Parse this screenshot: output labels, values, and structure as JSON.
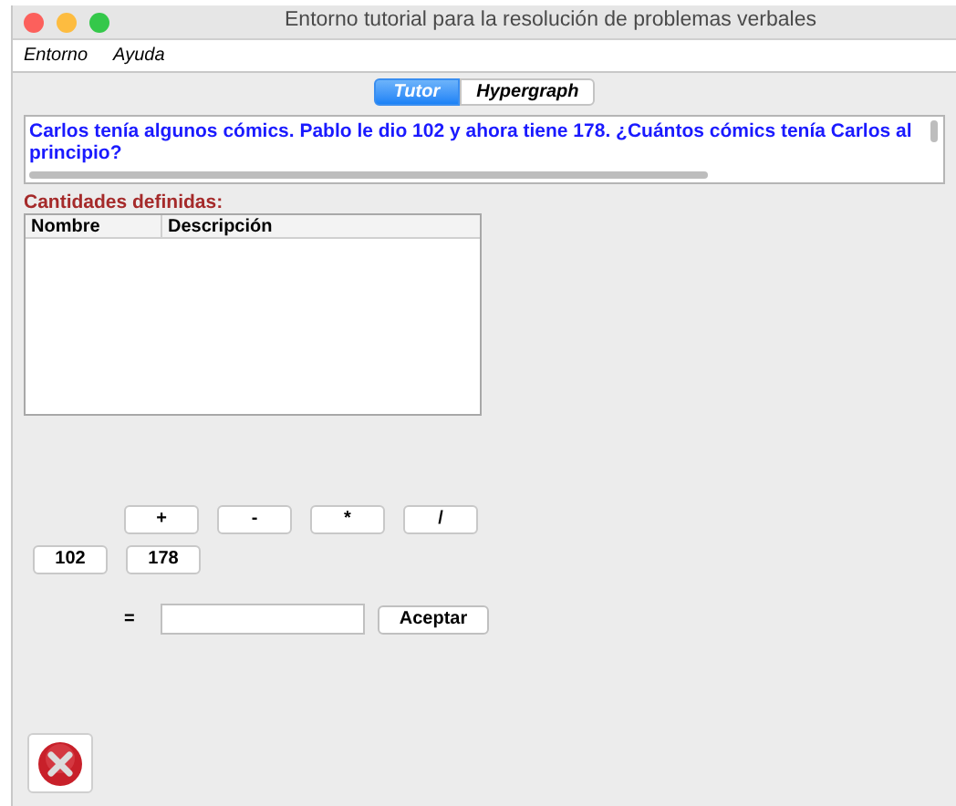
{
  "window": {
    "title": "Entorno tutorial para la resolución de problemas verbales"
  },
  "menu": [
    "Entorno",
    "Ayuda"
  ],
  "tabs": [
    {
      "label": "Tutor",
      "selected": true
    },
    {
      "label": "Hypergraph",
      "selected": false
    }
  ],
  "problem": "Carlos tenía algunos cómics. Pablo le dio 102 y ahora tiene 178. ¿Cuántos cómics tenía Carlos al principio?",
  "quantities": {
    "heading": "Cantidades definidas:",
    "columns": [
      "Nombre",
      "Descripción"
    ]
  },
  "operators": [
    "+",
    "-",
    "*",
    "/"
  ],
  "numbers": [
    "102",
    "178"
  ],
  "equals": "=",
  "accept": "Aceptar"
}
